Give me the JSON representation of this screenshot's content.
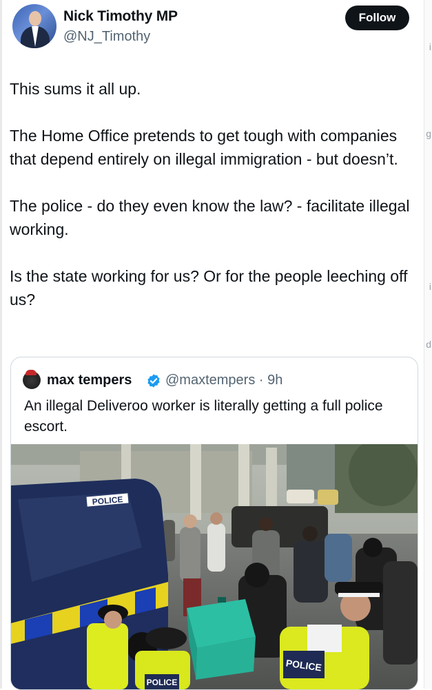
{
  "author": {
    "display_name": "Nick Timothy MP",
    "handle": "@NJ_Timothy",
    "follow_label": "Follow"
  },
  "tweet": {
    "paragraphs": [
      "This sums it all up.",
      "The Home Office pretends to get tough with companies that depend entirely on illegal immigration - but doesn’t.",
      "The police - do they even know the law? - facilitate illegal working.",
      "Is the state working for us? Or for the people leeching off us?"
    ]
  },
  "quoted_tweet": {
    "display_name": "max tempers",
    "handle_and_time": "@maxtempers · 9h",
    "text": "An illegal Deliveroo worker is literally getting a full police escort.",
    "media": {
      "van_label": "POLICE",
      "vest_label_right": "POLICE",
      "vest_label_left": "POLICE"
    }
  },
  "icons": {
    "verified": "verified-badge-icon"
  },
  "colors": {
    "follow_bg": "#0f1419",
    "verified": "#1d9bf0",
    "secondary_text": "#536471",
    "card_border": "#cfd9de"
  }
}
